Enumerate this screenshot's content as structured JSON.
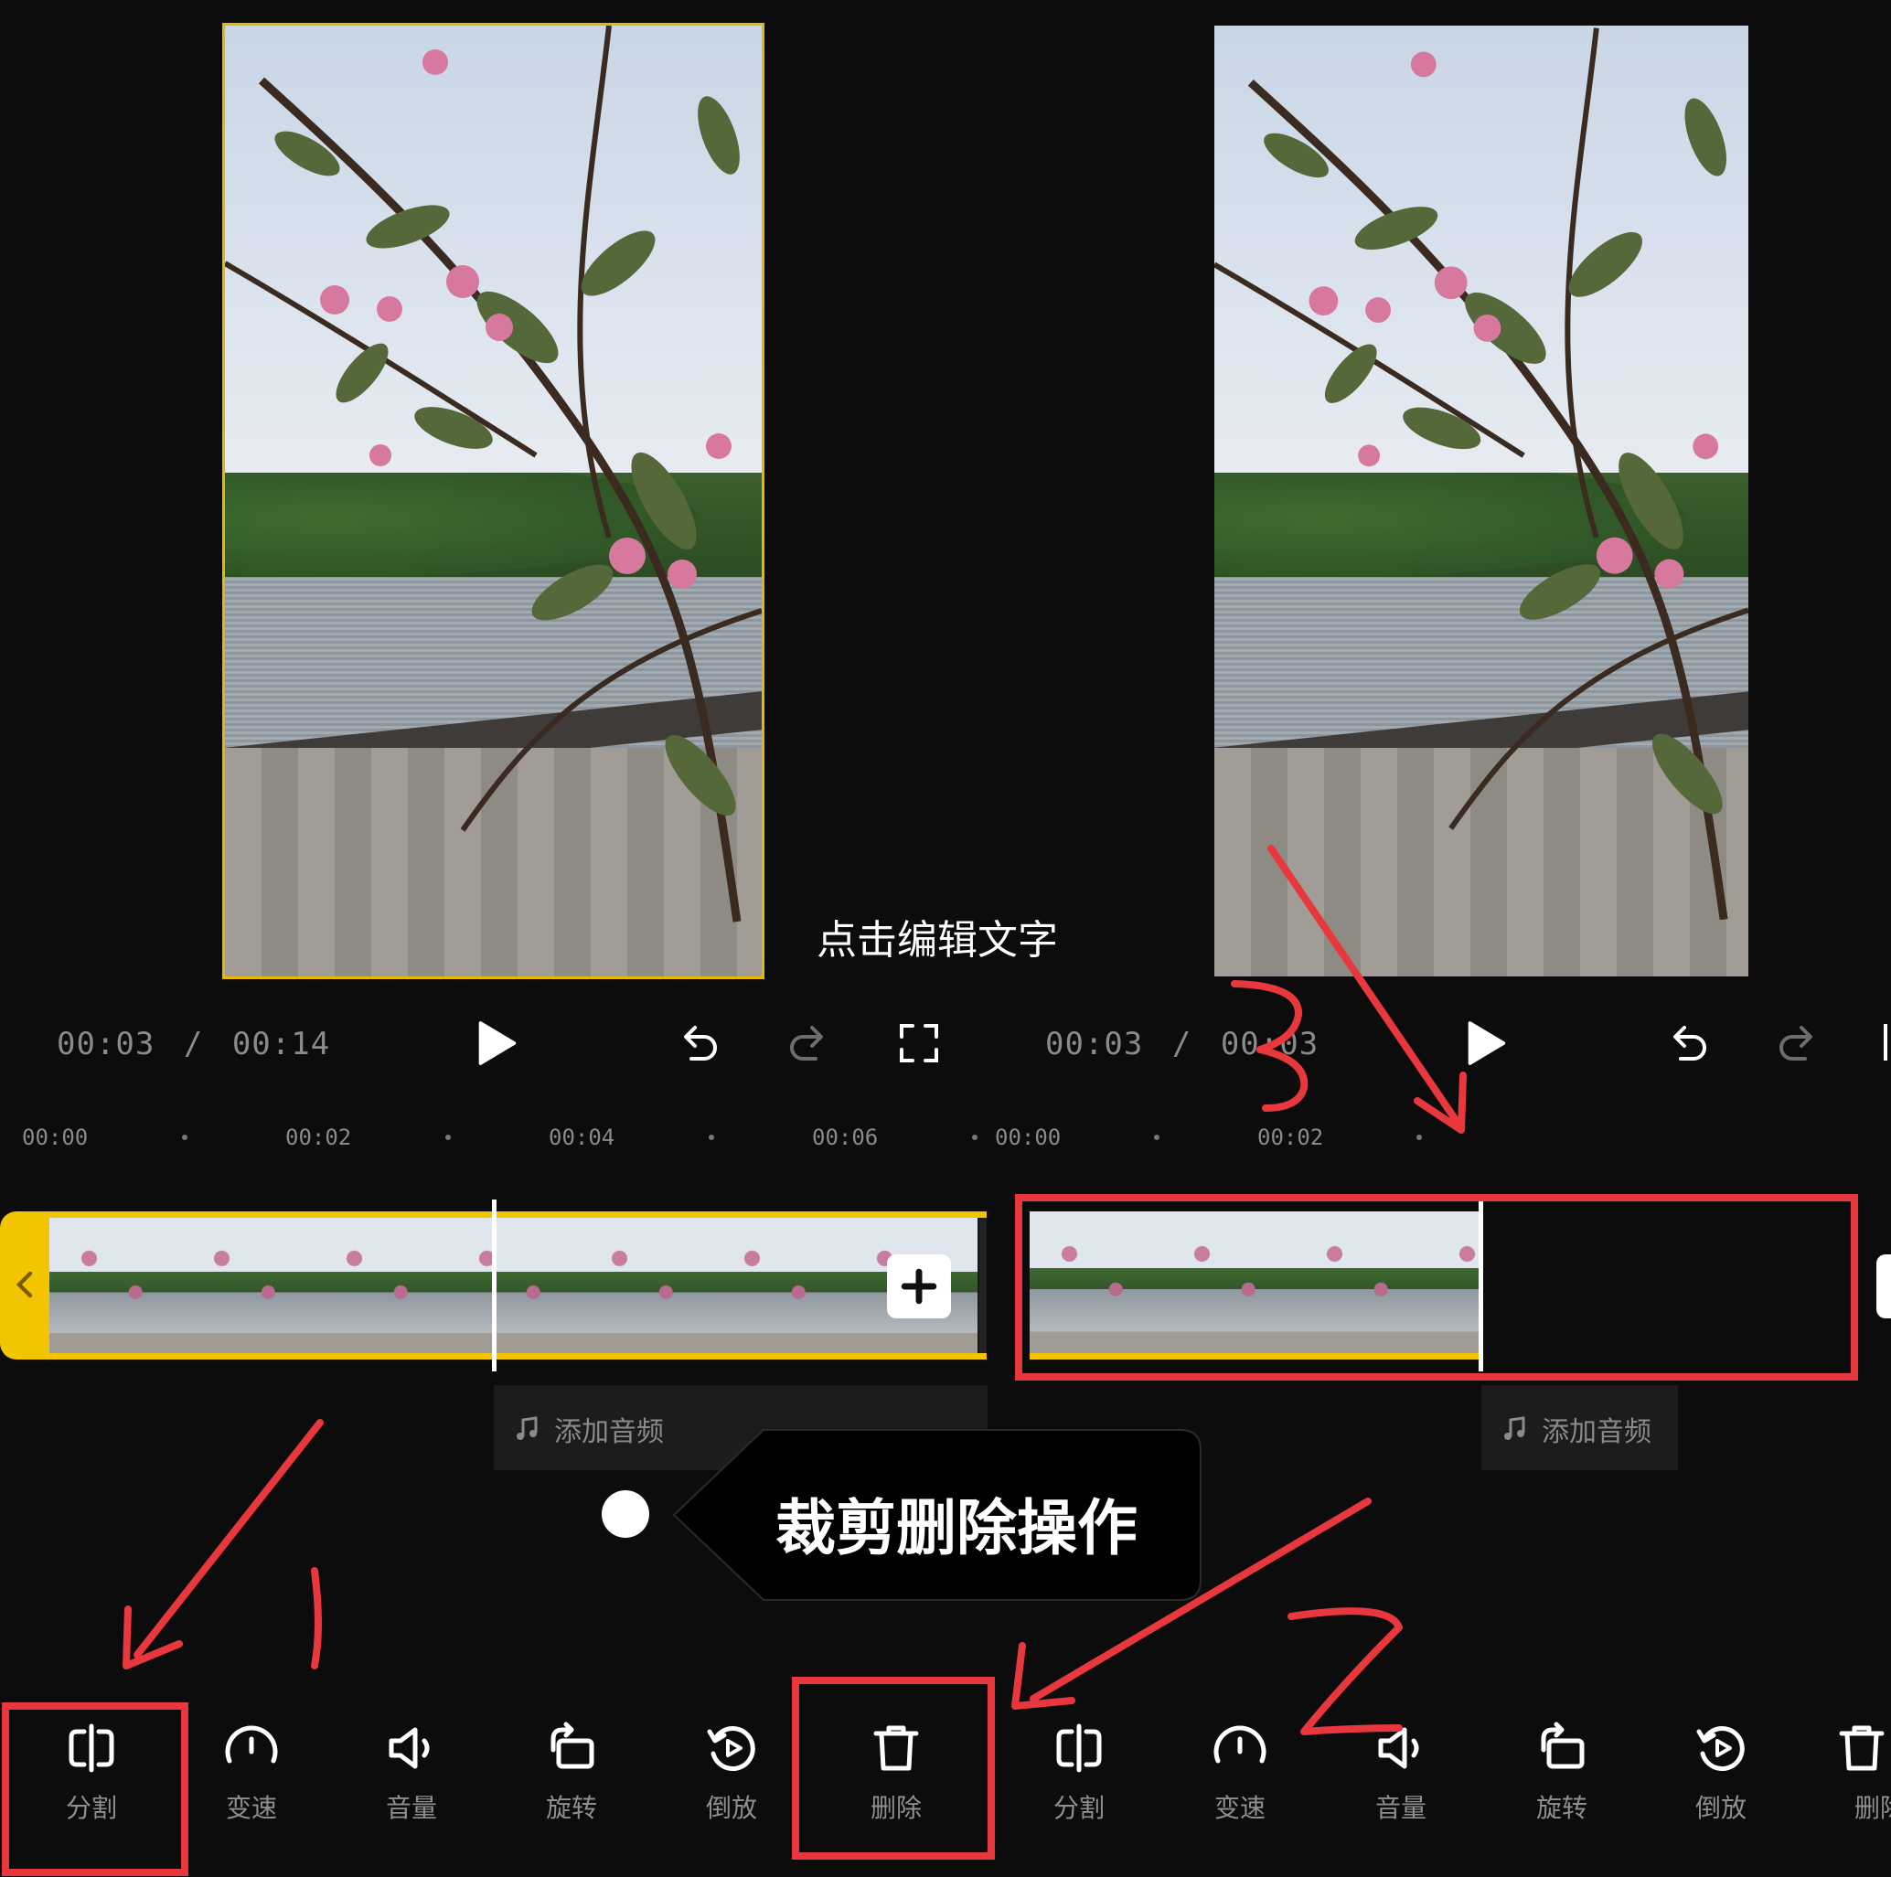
{
  "left_panel": {
    "time_current": "00:03",
    "time_separator": "/",
    "time_total": "00:14",
    "ruler": [
      "00:00",
      "00:02",
      "00:04",
      "00:06"
    ],
    "text_hint": "点击编辑文字",
    "add_audio": "添加音频"
  },
  "right_panel": {
    "time_current": "00:03",
    "time_separator": "/",
    "time_total": "00:03",
    "ruler": [
      "00:00",
      "00:02"
    ],
    "add_audio": "添加音频"
  },
  "callout": {
    "text": "裁剪删除操作"
  },
  "annotations": {
    "step1": "1",
    "step2": "2",
    "step3": "3"
  },
  "toolbar_left": [
    "分割",
    "变速",
    "音量",
    "旋转",
    "倒放",
    "删除"
  ],
  "toolbar_right": [
    "分割",
    "变速",
    "音量",
    "旋转",
    "倒放",
    "删除"
  ],
  "colors": {
    "background": "#0c0c0d",
    "selection": "#f2c500",
    "annotation_red": "#e8383d",
    "label": "#8f8f8f"
  },
  "icons": {
    "split": "split-icon",
    "speed": "speedometer-icon",
    "volume": "speaker-icon",
    "rotate": "rotate-icon",
    "reverse": "reverse-play-icon",
    "delete": "trash-icon",
    "play": "play-icon",
    "undo": "undo-icon",
    "redo": "redo-icon",
    "fullscreen": "fullscreen-icon",
    "add_clip": "plus-icon",
    "audio": "music-note-icon"
  }
}
